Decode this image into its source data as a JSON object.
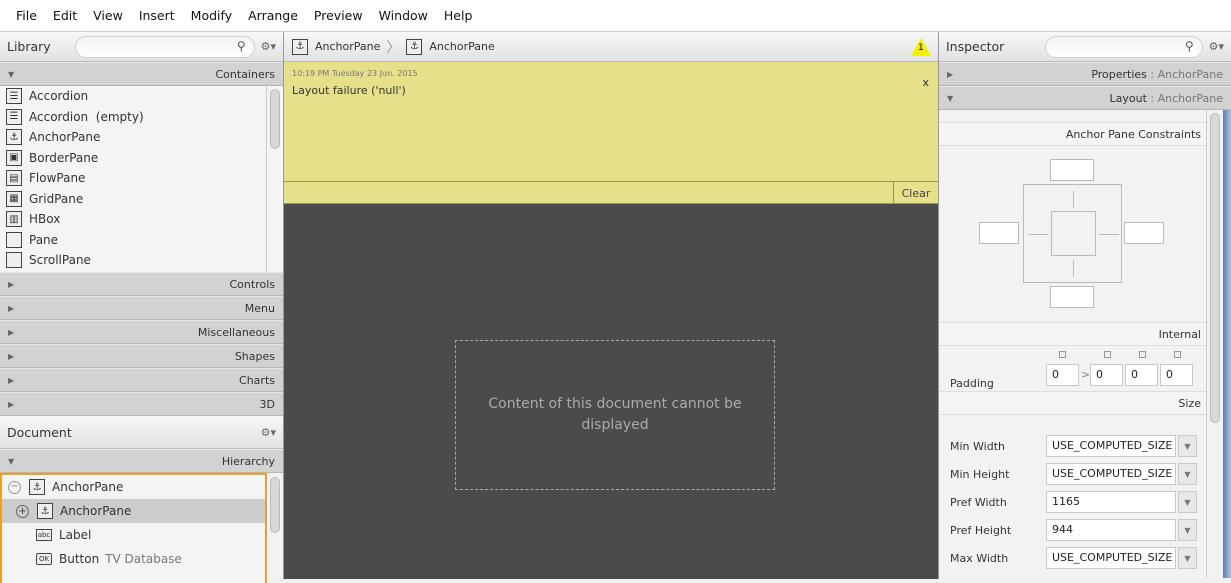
{
  "menu": [
    "File",
    "Edit",
    "View",
    "Insert",
    "Modify",
    "Arrange",
    "Preview",
    "Window",
    "Help"
  ],
  "library": {
    "title": "Library",
    "search_placeholder": "",
    "containers_label": "Containers",
    "items": [
      {
        "label": "Accordion",
        "icon": "accordion-icon"
      },
      {
        "label": "Accordion  (empty)",
        "icon": "accordion-icon"
      },
      {
        "label": "AnchorPane",
        "icon": "anchor-icon"
      },
      {
        "label": "BorderPane",
        "icon": "borderpane-icon"
      },
      {
        "label": "FlowPane",
        "icon": "flowpane-icon"
      },
      {
        "label": "GridPane",
        "icon": "gridpane-icon"
      },
      {
        "label": "HBox",
        "icon": "hbox-icon"
      },
      {
        "label": "Pane",
        "icon": "pane-icon"
      },
      {
        "label": "ScrollPane",
        "icon": "scrollpane-icon"
      }
    ],
    "sections": [
      "Controls",
      "Menu",
      "Miscellaneous",
      "Shapes",
      "Charts",
      "3D"
    ]
  },
  "document": {
    "title": "Document",
    "hierarchy_label": "Hierarchy",
    "tree": [
      {
        "label": "AnchorPane",
        "extra": ""
      },
      {
        "label": "AnchorPane",
        "extra": ""
      },
      {
        "label": "Label",
        "extra": ""
      },
      {
        "label": "Button",
        "extra": "TV Database"
      }
    ]
  },
  "breadcrumb": [
    "AnchorPane",
    "AnchorPane"
  ],
  "message": {
    "timestamp": "10:19 PM Tuesday 23 Jun. 2015",
    "text": "Layout failure ('null')",
    "close": "x",
    "clear": "Clear",
    "warning_count": "1"
  },
  "canvas": {
    "message": "Content of this document cannot be displayed"
  },
  "inspector": {
    "title": "Inspector",
    "properties_label": "Properties",
    "layout_label": "Layout",
    "sep": " : ",
    "target": "AnchorPane",
    "anchor_title": "Anchor Pane Constraints",
    "internal_title": "Internal",
    "padding_label": "Padding",
    "padding": [
      "0",
      "0",
      "0",
      "0"
    ],
    "padding_link": ">",
    "size_title": "Size",
    "sizes": [
      {
        "label": "Min Width",
        "value": "USE_COMPUTED_SIZE"
      },
      {
        "label": "Min Height",
        "value": "USE_COMPUTED_SIZE"
      },
      {
        "label": "Pref Width",
        "value": "1165"
      },
      {
        "label": "Pref Height",
        "value": "944"
      },
      {
        "label": "Max Width",
        "value": "USE_COMPUTED_SIZE"
      }
    ]
  },
  "colors": {
    "message_bg": "#e6e08b",
    "canvas_bg": "#4b4b4b",
    "selection": "#e8a030"
  }
}
